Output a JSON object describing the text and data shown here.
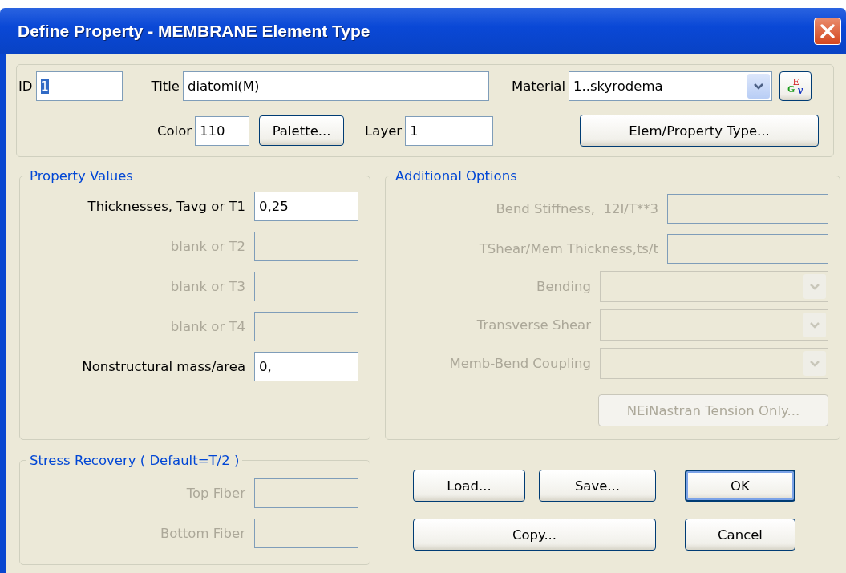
{
  "window": {
    "title": "Define Property - MEMBRANE Element Type"
  },
  "header": {
    "id": {
      "label": "ID",
      "value": "1",
      "highlighted": true
    },
    "title": {
      "label": "Title",
      "value": "diatomi(M)"
    },
    "material": {
      "label": "Material",
      "value": "1..skyrodema"
    },
    "material_button": {
      "symbols": [
        "G",
        "E",
        "ν"
      ]
    },
    "color": {
      "label": "Color",
      "value": "110"
    },
    "palette_button": "Palette...",
    "layer": {
      "label": "Layer",
      "value": "1"
    },
    "type_button": "Elem/Property Type..."
  },
  "property_values": {
    "title": "Property Values",
    "fields": [
      {
        "label": "Thicknesses, Tavg or T1",
        "value": "0,25",
        "disabled": false
      },
      {
        "label": "blank or T2",
        "disabled": true
      },
      {
        "label": "blank or T3",
        "disabled": true
      },
      {
        "label": "blank or T4",
        "disabled": true
      },
      {
        "label": "Nonstructural mass/area",
        "value": "0,",
        "disabled": false
      }
    ]
  },
  "stress_recovery": {
    "title": "Stress Recovery ( Default=T/2 )",
    "fields": [
      {
        "label": "Top Fiber",
        "disabled": true
      },
      {
        "label": "Bottom Fiber",
        "disabled": true
      }
    ]
  },
  "additional_options": {
    "title": "Additional Options",
    "fields": [
      {
        "kind": "text",
        "label": "Bend Stiffness,  12I/T**3",
        "disabled": true
      },
      {
        "kind": "text",
        "label": "TShear/Mem Thickness,ts/t",
        "disabled": true
      },
      {
        "kind": "select",
        "label": "Bending",
        "disabled": true
      },
      {
        "kind": "select",
        "label": "Transverse Shear",
        "disabled": true
      },
      {
        "kind": "select",
        "label": "Memb-Bend Coupling",
        "disabled": true
      }
    ],
    "tension_button": {
      "label": "NEiNastran Tension Only...",
      "disabled": true
    }
  },
  "buttons": [
    [
      {
        "label": "Load...",
        "default": false
      },
      {
        "label": "Save...",
        "default": false
      },
      {
        "label": "OK",
        "default": true
      }
    ],
    [
      {
        "label": "Copy...",
        "default": false
      },
      {
        "label": "Cancel",
        "default": false
      }
    ]
  ]
}
